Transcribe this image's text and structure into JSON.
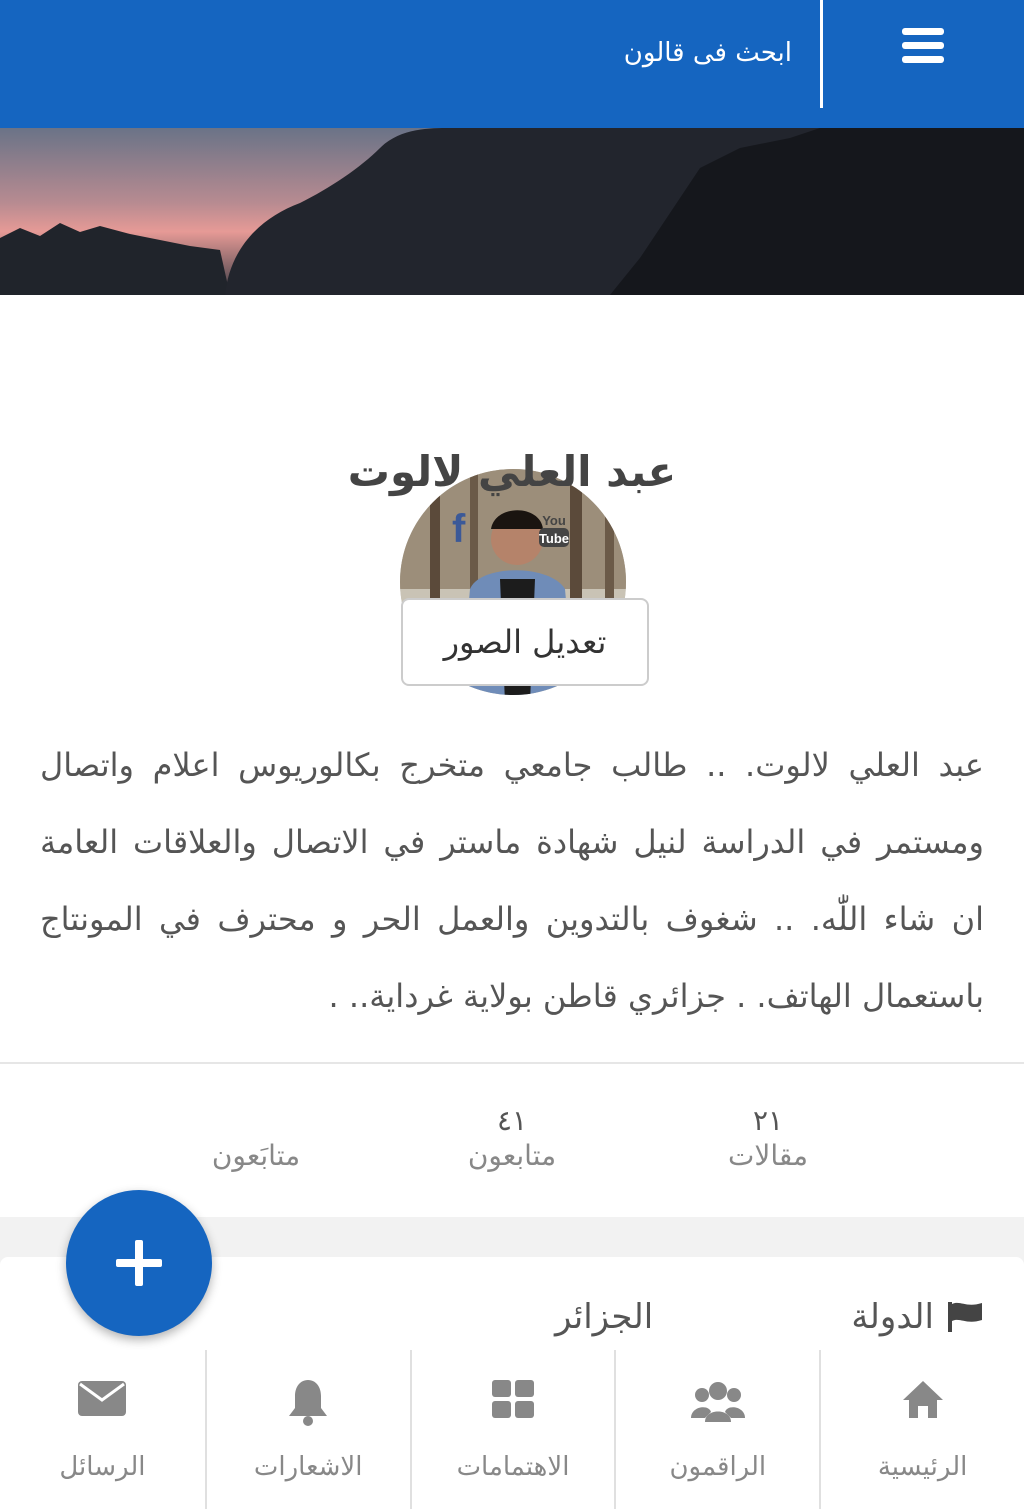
{
  "header": {
    "search_placeholder": "ابحث فى قالون",
    "menu_icon": "hamburger-icon"
  },
  "profile": {
    "name": "عبد العلي لالوت",
    "edit_button": "تعديل الصور",
    "social": [
      "facebook-icon",
      "youtube-icon"
    ],
    "bio": "عبد العلي لالوت. .. طالب جامعي متخرج بكالوريوس اعلام واتصال ومستمر في الدراسة لنيل شهادة ماستر في الاتصال والعلاقات العامة ان شاء اللّٰه. .. شغوف بالتدوين والعمل الحر و محترف في المونتاج باستعمال الهاتف. . جزائري قاطن بولاية غرداية.. ."
  },
  "stats": [
    {
      "num": "٢١",
      "label": "مقالات"
    },
    {
      "num": "٤١",
      "label": "متابعون"
    },
    {
      "num": "",
      "label": "متابَعون"
    }
  ],
  "info": {
    "country_label": "الدولة",
    "country_value": "الجزائر"
  },
  "bottom_nav": [
    {
      "label": "الرئيسية",
      "icon": "home-icon"
    },
    {
      "label": "الراقمون",
      "icon": "users-icon"
    },
    {
      "label": "الاهتمامات",
      "icon": "grid-icon"
    },
    {
      "label": "الاشعارات",
      "icon": "bell-icon"
    },
    {
      "label": "الرسائل",
      "icon": "envelope-icon"
    }
  ],
  "colors": {
    "primary": "#1565c0",
    "facebook": "#3b5998"
  }
}
